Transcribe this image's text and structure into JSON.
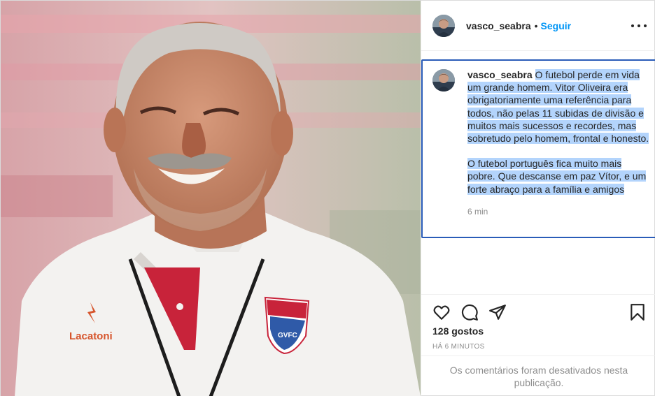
{
  "post": {
    "username": "vasco_seabra",
    "separator": "•",
    "follow_label": "Seguir",
    "more_icon": "more-horizontal-icon",
    "caption": {
      "username": "vasco_seabra",
      "paragraph_1": "O futebol perde em vida um grande homem. Vitor Oliveira era obrigatoriamente uma referência para todos, não pelas 11 subidas de divisão e muitos mais sucessos e recordes, mas sobretudo pelo homem, frontal e honesto.",
      "paragraph_2": "O futebol português fica muito mais pobre. Que descanse em paz Vítor, e um forte abraço para a família e amigos",
      "time": "6 min"
    },
    "actions": {
      "like_icon": "heart-icon",
      "comment_icon": "comment-icon",
      "share_icon": "paper-plane-icon",
      "save_icon": "bookmark-icon"
    },
    "likes": "128 gostos",
    "posted_ago": "HÁ 6 MINUTOS",
    "comments_disabled": "Os comentários foram desativados nesta publicação.",
    "photo": {
      "shirt_logo_text": "Lacatoni",
      "crest_text": "GVFC"
    }
  },
  "colors": {
    "link_blue": "#0095f6",
    "selection": "#b3d4fc",
    "focus_border": "#2a5cb8",
    "muted_text": "#8e8e8e"
  }
}
